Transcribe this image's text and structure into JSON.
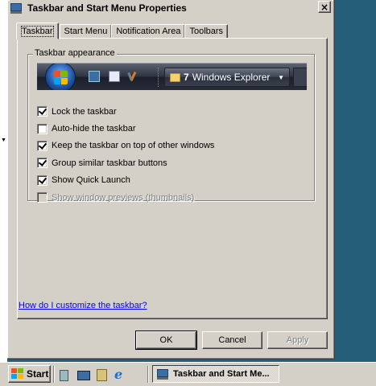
{
  "window": {
    "title": "Taskbar and Start Menu Properties",
    "close_label": "×"
  },
  "tabs": [
    {
      "label": "Taskbar",
      "active": true
    },
    {
      "label": "Start Menu",
      "active": false
    },
    {
      "label": "Notification Area",
      "active": false
    },
    {
      "label": "Toolbars",
      "active": false
    }
  ],
  "group": {
    "label": "Taskbar appearance",
    "preview": {
      "button_count": "7",
      "button_label": "Windows Explorer"
    }
  },
  "options": [
    {
      "label": "Lock the taskbar",
      "checked": true,
      "enabled": true
    },
    {
      "label": "Auto-hide the taskbar",
      "checked": false,
      "enabled": true
    },
    {
      "label": "Keep the taskbar on top of other windows",
      "checked": true,
      "enabled": true
    },
    {
      "label": "Group similar taskbar buttons",
      "checked": true,
      "enabled": true
    },
    {
      "label": "Show Quick Launch",
      "checked": true,
      "enabled": true
    },
    {
      "label": "Show window previews (thumbnails)",
      "checked": false,
      "enabled": false
    }
  ],
  "help_link": "How do I customize the taskbar?",
  "buttons": {
    "ok": "OK",
    "cancel": "Cancel",
    "apply": "Apply"
  },
  "taskbar": {
    "start_label": "Start",
    "ie_glyph": "e",
    "task_label": "Taskbar and Start Me..."
  }
}
